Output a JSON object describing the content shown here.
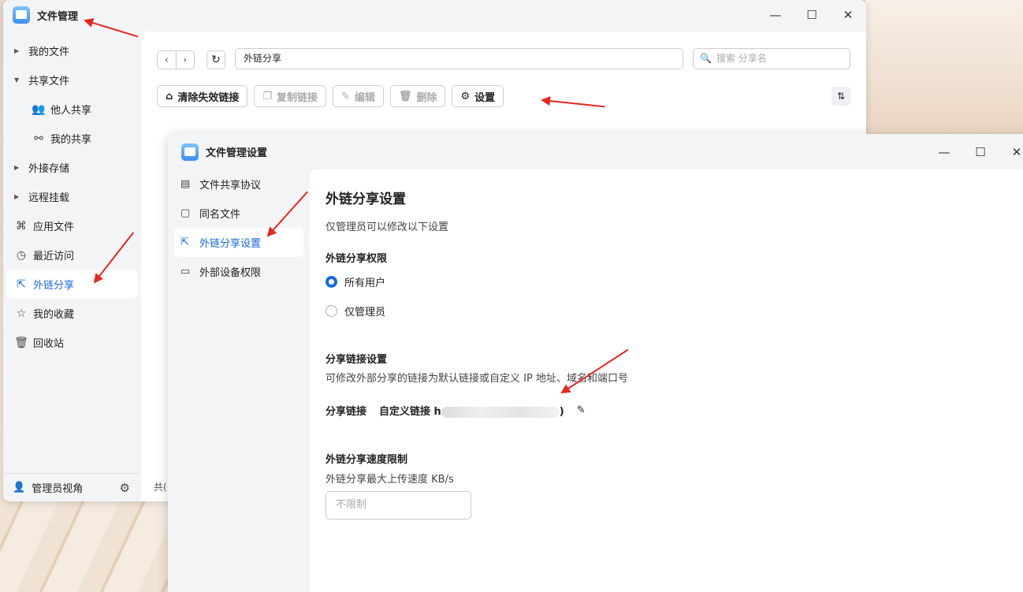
{
  "main_window": {
    "title": "文件管理",
    "sidebar": {
      "items": [
        {
          "label": "我的文件"
        },
        {
          "label": "共享文件"
        },
        {
          "label": "他人共享"
        },
        {
          "label": "我的共享"
        },
        {
          "label": "外接存储"
        },
        {
          "label": "远程挂载"
        },
        {
          "label": "应用文件"
        },
        {
          "label": "最近访问"
        },
        {
          "label": "外链分享"
        },
        {
          "label": "我的收藏"
        },
        {
          "label": "回收站"
        }
      ],
      "bottom_label": "管理员视角"
    },
    "path": "外链分享",
    "search_placeholder": "搜索 分享名",
    "toolbar": {
      "clear": "清除失效链接",
      "copy": "复制链接",
      "edit": "编辑",
      "delete": "删除",
      "settings": "设置"
    },
    "footer_count": "共("
  },
  "settings_window": {
    "title": "文件管理设置",
    "menu": [
      {
        "label": "文件共享协议"
      },
      {
        "label": "同名文件"
      },
      {
        "label": "外链分享设置"
      },
      {
        "label": "外部设备权限"
      }
    ],
    "heading": "外链分享设置",
    "note": "仅管理员可以修改以下设置",
    "permission": {
      "title": "外链分享权限",
      "option_all": "所有用户",
      "option_admin": "仅管理员",
      "selected": "所有用户"
    },
    "link": {
      "title": "分享链接设置",
      "desc": "可修改外部分享的链接为默认链接或自定义 IP 地址、域名和端口号",
      "label": "分享链接",
      "value_prefix": "自定义链接 h",
      "value_suffix": ")"
    },
    "speed": {
      "title": "外链分享速度限制",
      "desc": "外链分享最大上传速度 KB/s",
      "placeholder": "不限制"
    }
  },
  "colors": {
    "accent": "#1769e0",
    "annotation_arrow": "#e5271f"
  }
}
